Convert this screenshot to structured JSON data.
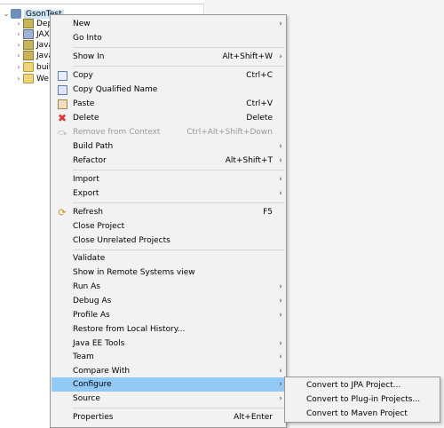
{
  "explorer": {
    "root": {
      "label": "GsonTest",
      "twisty": "⌄"
    },
    "children": [
      {
        "label": "Dep",
        "icon": "library-icon",
        "twisty": "›"
      },
      {
        "label": "JAX",
        "icon": "jaxws-icon",
        "twisty": "›"
      },
      {
        "label": "Java",
        "icon": "java-resources-icon",
        "twisty": "›"
      },
      {
        "label": "Java",
        "icon": "library-icon",
        "twisty": "›"
      },
      {
        "label": "buil",
        "icon": "folder-icon",
        "twisty": "›"
      },
      {
        "label": "We",
        "icon": "folder-icon",
        "twisty": "›"
      }
    ]
  },
  "context_menu": {
    "items": [
      {
        "label": "New",
        "shortcut": "",
        "arrow": "›"
      },
      {
        "label": "Go Into",
        "shortcut": "",
        "arrow": ""
      },
      {
        "label": "Show In",
        "shortcut": "Alt+Shift+W",
        "arrow": "›"
      },
      {
        "label": "Copy",
        "shortcut": "Ctrl+C",
        "arrow": "",
        "icon": "copy-icon"
      },
      {
        "label": "Copy Qualified Name",
        "shortcut": "",
        "arrow": "",
        "icon": "copy-qualified-name-icon"
      },
      {
        "label": "Paste",
        "shortcut": "Ctrl+V",
        "arrow": "",
        "icon": "paste-icon"
      },
      {
        "label": "Delete",
        "shortcut": "Delete",
        "arrow": "",
        "icon": "delete-icon"
      },
      {
        "label": "Remove from Context",
        "shortcut": "Ctrl+Alt+Shift+Down",
        "arrow": "",
        "icon": "remove-from-context-icon",
        "disabled": true
      },
      {
        "label": "Build Path",
        "shortcut": "",
        "arrow": "›"
      },
      {
        "label": "Refactor",
        "shortcut": "Alt+Shift+T",
        "arrow": "›"
      },
      {
        "label": "Import",
        "shortcut": "",
        "arrow": "›"
      },
      {
        "label": "Export",
        "shortcut": "",
        "arrow": "›"
      },
      {
        "label": "Refresh",
        "shortcut": "F5",
        "arrow": "",
        "icon": "refresh-icon"
      },
      {
        "label": "Close Project",
        "shortcut": "",
        "arrow": ""
      },
      {
        "label": "Close Unrelated Projects",
        "shortcut": "",
        "arrow": ""
      },
      {
        "label": "Validate",
        "shortcut": "",
        "arrow": ""
      },
      {
        "label": "Show in Remote Systems view",
        "shortcut": "",
        "arrow": ""
      },
      {
        "label": "Run As",
        "shortcut": "",
        "arrow": "›"
      },
      {
        "label": "Debug As",
        "shortcut": "",
        "arrow": "›"
      },
      {
        "label": "Profile As",
        "shortcut": "",
        "arrow": "›"
      },
      {
        "label": "Restore from Local History...",
        "shortcut": "",
        "arrow": ""
      },
      {
        "label": "Java EE Tools",
        "shortcut": "",
        "arrow": "›"
      },
      {
        "label": "Team",
        "shortcut": "",
        "arrow": "›"
      },
      {
        "label": "Compare With",
        "shortcut": "",
        "arrow": "›"
      },
      {
        "label": "Configure",
        "shortcut": "",
        "arrow": "›",
        "active": true
      },
      {
        "label": "Source",
        "shortcut": "",
        "arrow": "›"
      },
      {
        "label": "Properties",
        "shortcut": "Alt+Enter",
        "arrow": ""
      }
    ]
  },
  "submenu": {
    "items": [
      {
        "label": "Convert to JPA Project..."
      },
      {
        "label": "Convert to Plug-in Projects..."
      },
      {
        "label": "Convert to Maven Project"
      }
    ]
  },
  "colors": {
    "menu_bg": "#f2f2f2",
    "highlight": "#91c9f7",
    "selection": "#cde6f7",
    "disabled_text": "#9a9a9a"
  }
}
